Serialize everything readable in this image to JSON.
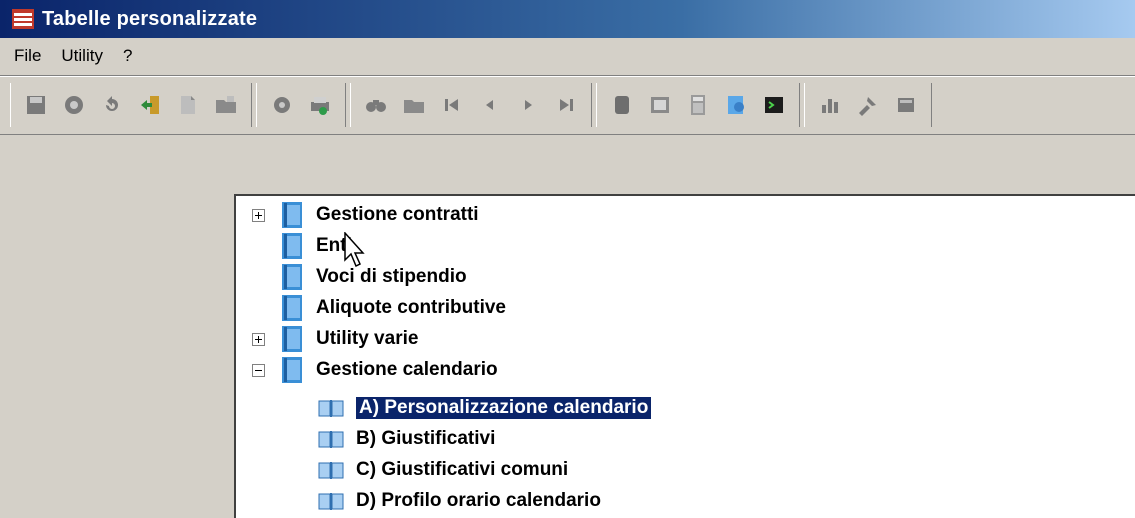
{
  "window": {
    "title": "Tabelle personalizzate"
  },
  "menu": {
    "items": [
      "File",
      "Utility",
      "?"
    ]
  },
  "toolbar": {
    "groups": [
      [
        "save-icon",
        "refresh-icon",
        "undo-icon",
        "exit-icon",
        "new-document-icon",
        "open-folder-icon"
      ],
      [
        "settings-icon",
        "print-icon"
      ],
      [
        "find-icon",
        "folder-icon",
        "first-record-icon",
        "previous-record-icon",
        "next-record-icon",
        "last-record-icon"
      ],
      [
        "stop-icon",
        "image-icon",
        "calculator-icon",
        "web-icon",
        "console-icon"
      ],
      [
        "chart-icon",
        "tools-icon",
        "document-icon"
      ]
    ]
  },
  "tree": {
    "items": [
      {
        "label": "Gestione contratti",
        "expander": "plus",
        "icon": "book-icon"
      },
      {
        "label": "Enti",
        "expander": null,
        "icon": "book-icon"
      },
      {
        "label": "Voci di stipendio",
        "expander": null,
        "icon": "book-icon"
      },
      {
        "label": "Aliquote contributive",
        "expander": null,
        "icon": "book-icon"
      },
      {
        "label": "Utility varie",
        "expander": "plus",
        "icon": "book-icon"
      },
      {
        "label": "Gestione calendario",
        "expander": "minus",
        "icon": "book-icon"
      },
      {
        "label": "A) Personalizzazione calendario",
        "expander": null,
        "icon": "open-book-icon",
        "selected": true
      },
      {
        "label": "B) Giustificativi",
        "expander": null,
        "icon": "open-book-icon"
      },
      {
        "label": "C) Giustificativi comuni",
        "expander": null,
        "icon": "open-book-icon"
      },
      {
        "label": "D) Profilo orario calendario",
        "expander": null,
        "icon": "open-book-icon"
      }
    ]
  },
  "colors": {
    "titlebar": "#0a246a",
    "selection": "#0a246a",
    "book": "#3a8fd6"
  }
}
